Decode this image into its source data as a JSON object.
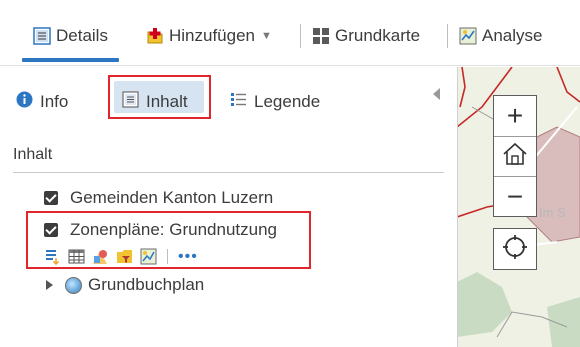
{
  "toolbar": {
    "details_label": "Details",
    "add_label": "Hinzufügen",
    "basemap_label": "Grundkarte",
    "analysis_label": "Analyse",
    "accent_color": "#2d76c2"
  },
  "panel": {
    "tabs": [
      {
        "label": "Info",
        "icon": "info-icon"
      },
      {
        "label": "Inhalt",
        "icon": "content-icon",
        "active": true
      },
      {
        "label": "Legende",
        "icon": "legend-icon"
      }
    ],
    "section_title": "Inhalt",
    "layers": [
      {
        "label": "Gemeinden Kanton Luzern",
        "checked": true
      },
      {
        "label": "Zonenpläne: Grundnutzung",
        "checked": true
      },
      {
        "label": "Grundbuchplan",
        "checked": false,
        "expandable": true
      }
    ],
    "layer_tools": [
      "show-table-icon",
      "table-icon",
      "change-style-icon",
      "filter-icon",
      "analysis-icon",
      "more-options-icon"
    ],
    "more_label": "•••",
    "highlight_color": "#e0262a"
  },
  "map": {
    "zoom_in": "+",
    "zoom_out": "−",
    "map_label_fragment": "Im S"
  }
}
